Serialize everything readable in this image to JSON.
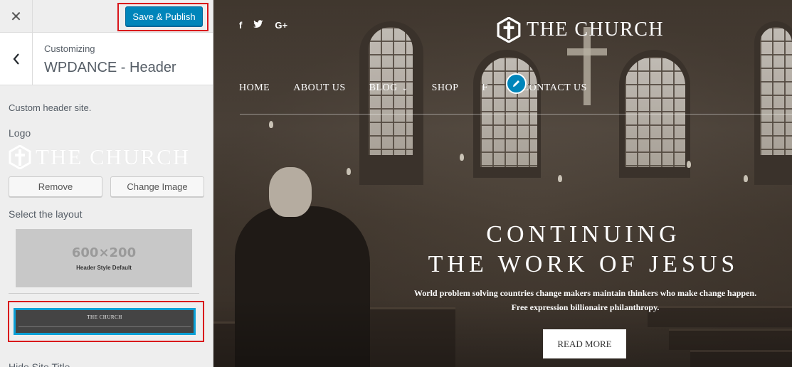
{
  "customizer": {
    "close_icon": "close-icon",
    "publish_label": "Save & Publish",
    "back_icon": "chevron-left-icon",
    "customizing_label": "Customizing",
    "section_title": "WPDANCE - Header",
    "section_description": "Custom header site.",
    "logo_label": "Logo",
    "logo_preview_text": "THE CHURCH",
    "remove_label": "Remove",
    "change_image_label": "Change Image",
    "layout_label": "Select the layout",
    "layout_options": [
      {
        "size_text": "600×200",
        "name": "Header Style Default"
      },
      {
        "title": "THE CHURCH",
        "selected": true
      }
    ],
    "hide_title_label": "Hide Site Title"
  },
  "site": {
    "social": [
      "f",
      "twitter-icon",
      "G+"
    ],
    "title": "THE CHURCH",
    "nav": [
      "HOME",
      "ABOUT US",
      "BLOG",
      "SHOP",
      "F",
      "CONTACT US"
    ],
    "hero": {
      "line1": "CONTINUING",
      "line2": "THE WORK OF JESUS",
      "sub1": "World problem solving countries change makers maintain thinkers who make change happen.",
      "sub2": "Free expression billionaire philanthropy.",
      "button": "READ MORE"
    }
  },
  "colors": {
    "accent": "#0085ba",
    "highlight": "#d9151b",
    "selected_border": "#0aa0d6"
  }
}
